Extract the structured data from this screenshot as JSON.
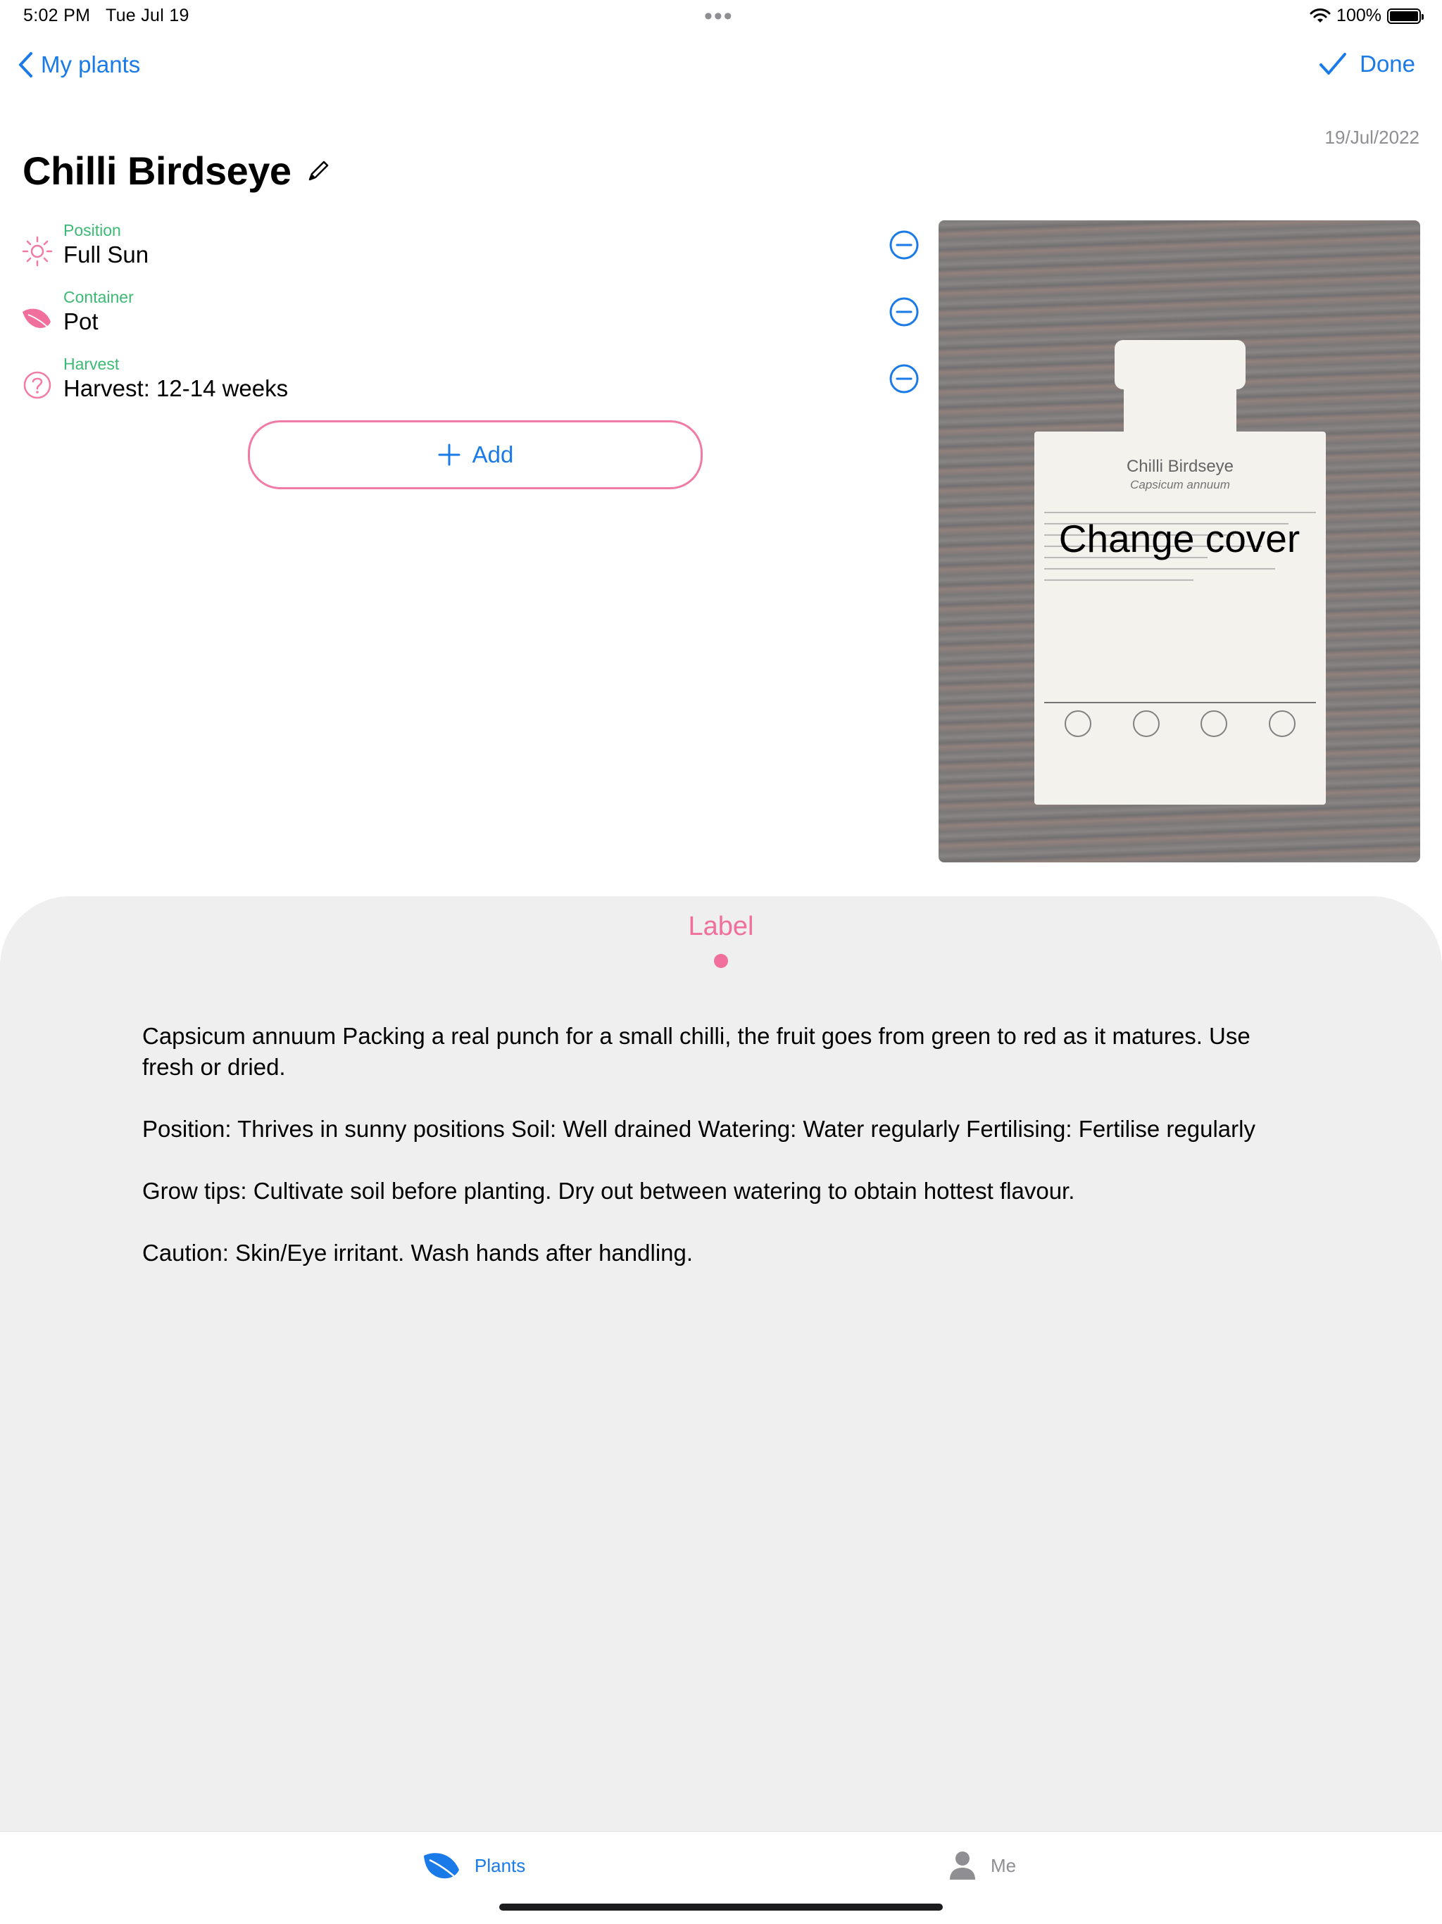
{
  "status_bar": {
    "time": "5:02 PM",
    "date": "Tue Jul 19",
    "battery": "100%",
    "battery_level": 1.0
  },
  "nav": {
    "back_label": "My plants",
    "done_label": "Done"
  },
  "plant": {
    "date": "19/Jul/2022",
    "name": "Chilli Birdseye"
  },
  "attributes": [
    {
      "label": "Position",
      "value": "Full Sun",
      "icon": "sun-icon"
    },
    {
      "label": "Container",
      "value": "Pot",
      "icon": "leaf-icon"
    },
    {
      "label": "Harvest",
      "value": "Harvest: 12-14 weeks",
      "icon": "question-icon"
    }
  ],
  "add_label": "Add",
  "cover": {
    "action_label": "Change cover",
    "packet_title": "Chilli Birdseye",
    "packet_subtitle": "Capsicum annuum"
  },
  "sheet": {
    "title": "Label",
    "paragraphs": [
      "Capsicum annuum Packing a real punch for a small chilli, the fruit goes from green to red as it matures. Use fresh or dried.",
      "Position: Thrives in sunny positions Soil: Well drained Watering: Water regularly Fertilising: Fertilise regularly",
      "Grow tips: Cultivate soil before planting. Dry out between watering to obtain hottest flavour.",
      "Caution: Skin/Eye irritant. Wash hands after handling."
    ]
  },
  "tabs": {
    "plants": "Plants",
    "me": "Me"
  },
  "colors": {
    "accent_blue": "#1a7ae8",
    "accent_pink": "#f06f9c",
    "label_green": "#3cba73"
  }
}
